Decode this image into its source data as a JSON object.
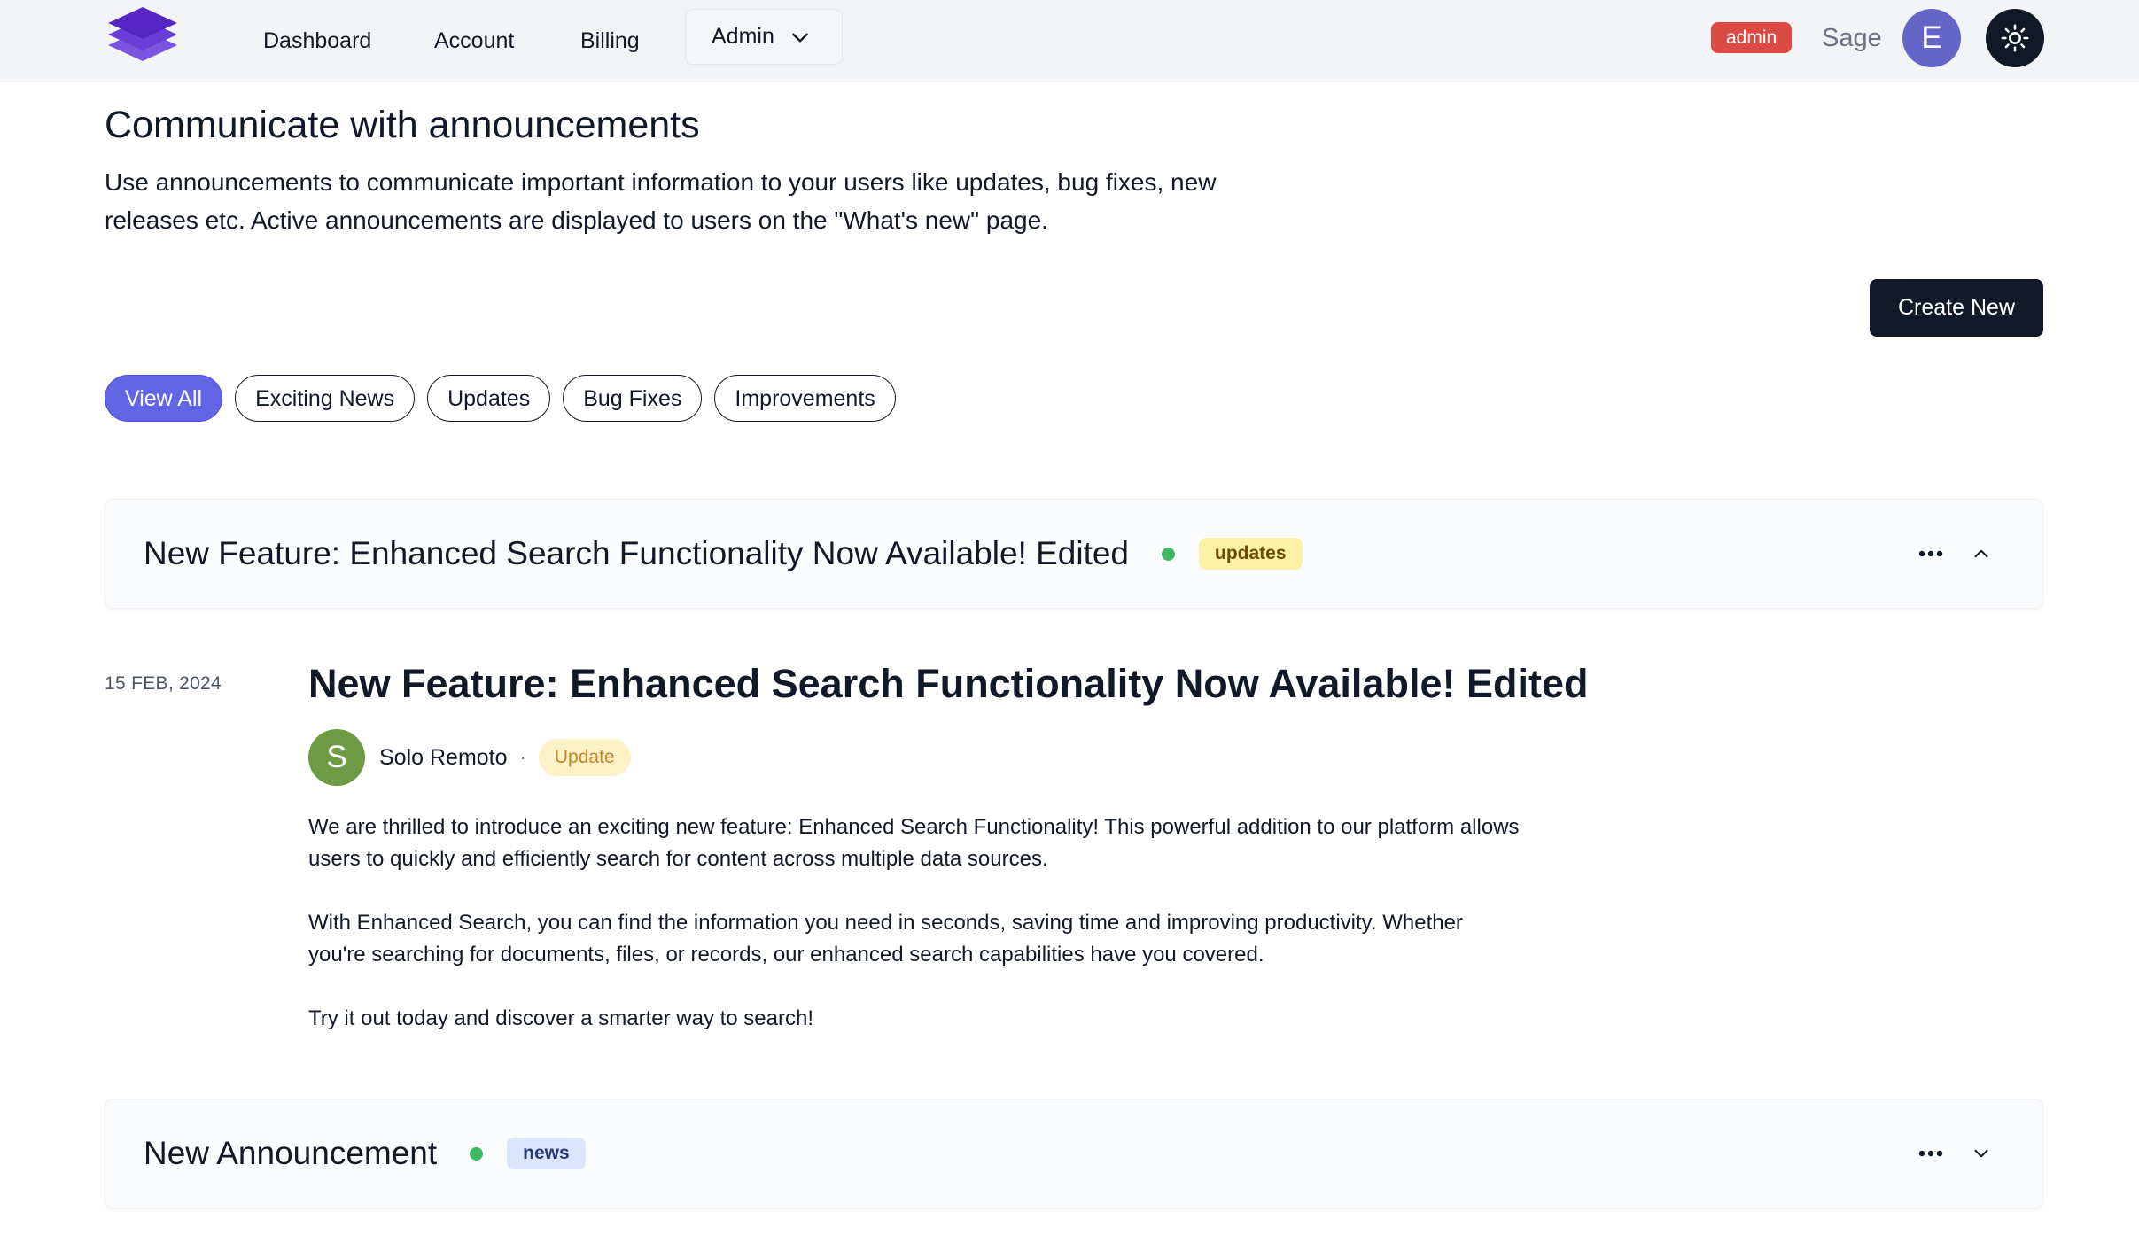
{
  "nav": {
    "links": [
      "Dashboard",
      "Account",
      "Billing"
    ],
    "admin_menu": "Admin",
    "role_badge": "admin",
    "username": "Sage",
    "avatar_initial": "E"
  },
  "header": {
    "title": "Communicate with announcements",
    "description": "Use announcements to communicate important information to your users like updates, bug fixes, new releases etc. Active announcements are displayed to users on the \"What's new\" page.",
    "create_button": "Create New"
  },
  "filters": {
    "chips": [
      "View All",
      "Exciting News",
      "Updates",
      "Bug Fixes",
      "Improvements"
    ],
    "active": "View All"
  },
  "announcements": [
    {
      "title": "New Feature: Enhanced Search Functionality Now Available! Edited",
      "tag": "updates",
      "status": "active",
      "expanded": true,
      "date": "15 FEB, 2024",
      "author": "Solo Remoto",
      "author_initial": "S",
      "category": "Update",
      "paragraphs": [
        "We are thrilled to introduce an exciting new feature: Enhanced Search Functionality! This powerful addition to our platform allows users to quickly and efficiently search for content across multiple data sources.",
        "With Enhanced Search, you can find the information you need in seconds, saving time and improving productivity. Whether you're searching for documents, files, or records, our enhanced search capabilities have you covered.",
        "Try it out today and discover a smarter way to search!"
      ]
    },
    {
      "title": "New Announcement",
      "tag": "news",
      "status": "active",
      "expanded": false
    }
  ],
  "colors": {
    "accent": "#6366e4",
    "dark": "#111827",
    "admin_badge": "#dc4a44",
    "status_dot": "#3dba64",
    "tag_updates_bg": "#fdf1a7",
    "tag_news_bg": "#dbe5fb"
  },
  "icons": [
    "logo-icon",
    "chevron-down-icon",
    "sun-icon",
    "more-icon",
    "chevron-up-icon"
  ]
}
